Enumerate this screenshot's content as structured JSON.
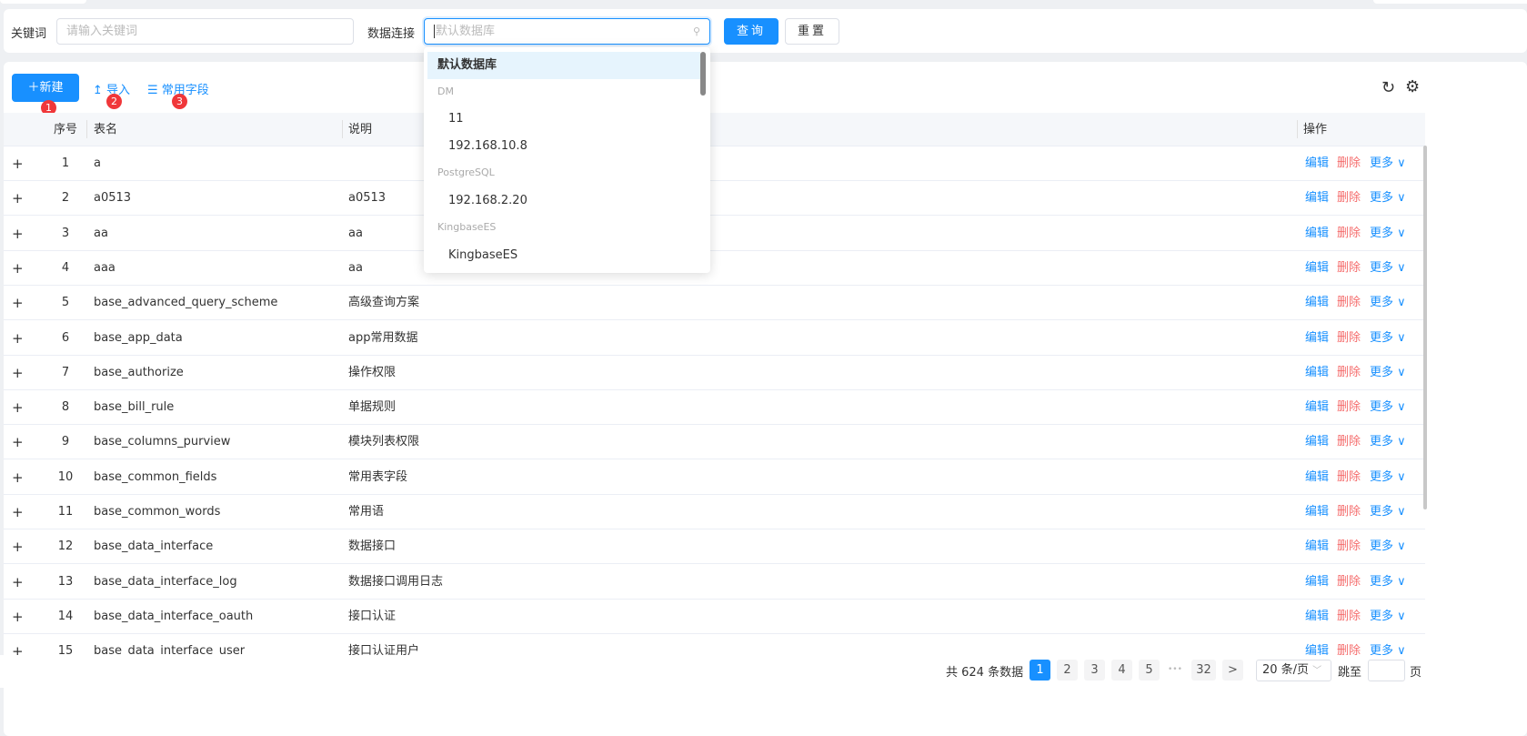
{
  "search": {
    "keyword_label": "关键词",
    "keyword_placeholder": "请输入关键词",
    "db_label": "数据连接",
    "db_placeholder": "默认数据库",
    "query_label": "查询",
    "reset_label": "重置"
  },
  "toolbar": {
    "new_label": "新建",
    "import_label": "导入",
    "fields_label": "常用字段",
    "badges": [
      "1",
      "2",
      "3"
    ]
  },
  "dropdown": {
    "selected": "默认数据库",
    "groups": [
      {
        "name": "DM",
        "items": [
          "11",
          "192.168.10.8"
        ]
      },
      {
        "name": "PostgreSQL",
        "items": [
          "192.168.2.20"
        ]
      },
      {
        "name": "KingbaseES",
        "items": [
          "KingbaseES"
        ]
      }
    ]
  },
  "table": {
    "headers": {
      "index": "序号",
      "name": "表名",
      "desc": "说明",
      "ops": "操作"
    },
    "actions": {
      "edit": "编辑",
      "delete": "删除",
      "more": "更多"
    },
    "rows": [
      {
        "i": "1",
        "name": "a",
        "desc": ""
      },
      {
        "i": "2",
        "name": "a0513",
        "desc": "a0513"
      },
      {
        "i": "3",
        "name": "aa",
        "desc": "aa"
      },
      {
        "i": "4",
        "name": "aaa",
        "desc": "aa"
      },
      {
        "i": "5",
        "name": "base_advanced_query_scheme",
        "desc": "高级查询方案"
      },
      {
        "i": "6",
        "name": "base_app_data",
        "desc": "app常用数据"
      },
      {
        "i": "7",
        "name": "base_authorize",
        "desc": "操作权限"
      },
      {
        "i": "8",
        "name": "base_bill_rule",
        "desc": "单据规则"
      },
      {
        "i": "9",
        "name": "base_columns_purview",
        "desc": "模块列表权限"
      },
      {
        "i": "10",
        "name": "base_common_fields",
        "desc": "常用表字段"
      },
      {
        "i": "11",
        "name": "base_common_words",
        "desc": "常用语"
      },
      {
        "i": "12",
        "name": "base_data_interface",
        "desc": "数据接口"
      },
      {
        "i": "13",
        "name": "base_data_interface_log",
        "desc": "数据接口调用日志"
      },
      {
        "i": "14",
        "name": "base_data_interface_oauth",
        "desc": "接口认证"
      },
      {
        "i": "15",
        "name": "base_data_interface_user",
        "desc": "接口认证用户"
      }
    ]
  },
  "pagination": {
    "total": "共 624 条数据",
    "pages": [
      "1",
      "2",
      "3",
      "4",
      "5"
    ],
    "ellipsis": "•••",
    "last": "32",
    "next": ">",
    "page_size": "20 条/页",
    "jump_label": "跳至",
    "page_suffix": "页"
  }
}
